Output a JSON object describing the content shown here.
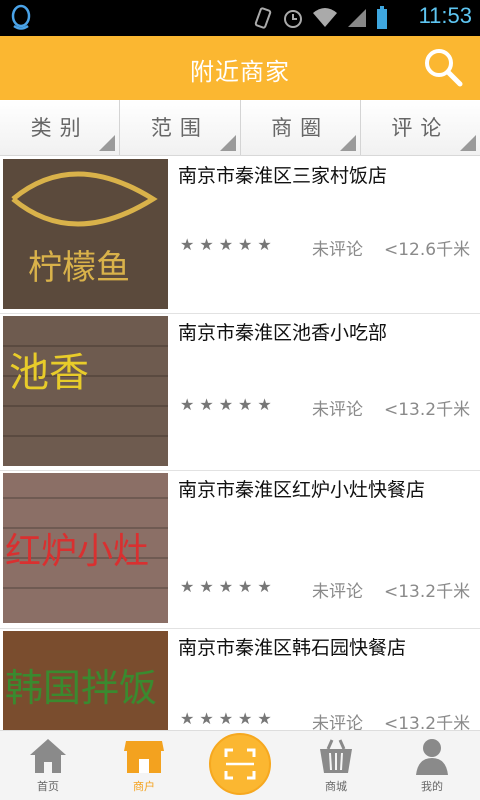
{
  "status_bar": {
    "time": "11:53"
  },
  "header": {
    "title": "附近商家",
    "search_icon": "search-icon"
  },
  "filters": [
    {
      "label": "类别"
    },
    {
      "label": "范围"
    },
    {
      "label": "商圈"
    },
    {
      "label": "评论"
    }
  ],
  "merchants": [
    {
      "name": "南京市秦淮区三家村饭店",
      "rating": 0,
      "review": "未评论",
      "distance": "<12.6千米",
      "sign_text": "柠檬鱼",
      "sign_bg": "#5b4a3c",
      "sign_fg": "#d9b24a"
    },
    {
      "name": "南京市秦淮区池香小吃部",
      "rating": 0,
      "review": "未评论",
      "distance": "<13.2千米",
      "sign_text": "池香",
      "sign_bg": "#6e5b4f",
      "sign_fg": "#e8cc2a"
    },
    {
      "name": "南京市秦淮区红炉小灶快餐店",
      "rating": 0,
      "review": "未评论",
      "distance": "<13.2千米",
      "sign_text": "红炉小灶",
      "sign_bg": "#8b6f66",
      "sign_fg": "#d93030"
    },
    {
      "name": "南京市秦淮区韩石园快餐店",
      "rating": 0,
      "review": "未评论",
      "distance": "<13.2千米",
      "sign_text": "韩国拌饭",
      "sign_bg": "#7a4d2e",
      "sign_fg": "#3a8a2f"
    }
  ],
  "tabbar": [
    {
      "label": "首页",
      "icon": "home-icon"
    },
    {
      "label": "商户",
      "icon": "shop-icon",
      "active": true
    },
    {
      "label": "",
      "icon": "scan-icon"
    },
    {
      "label": "商城",
      "icon": "basket-icon"
    },
    {
      "label": "我的",
      "icon": "user-icon"
    }
  ],
  "colors": {
    "accent": "#fbb731"
  }
}
